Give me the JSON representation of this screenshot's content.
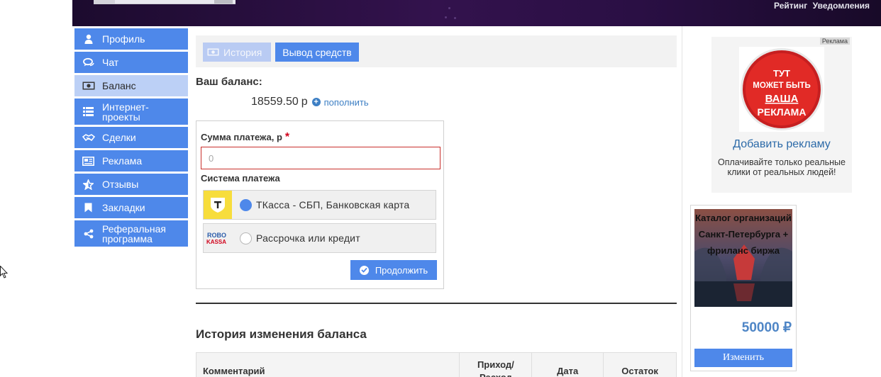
{
  "header": {
    "top_links": [
      "Рейтинг",
      "Уведомления"
    ]
  },
  "sidebar": {
    "items": [
      {
        "label": "Профиль",
        "icon": "user-icon",
        "active": false
      },
      {
        "label": "Чат",
        "icon": "chat-icon",
        "active": false
      },
      {
        "label": "Баланс",
        "icon": "money-icon",
        "active": true
      },
      {
        "label": "Интернет-проекты",
        "icon": "list-icon",
        "active": false
      },
      {
        "label": "Сделки",
        "icon": "handshake-icon",
        "active": false
      },
      {
        "label": "Реклама",
        "icon": "newspaper-icon",
        "active": false
      },
      {
        "label": "Отзывы",
        "icon": "star-icon",
        "active": false
      },
      {
        "label": "Закладки",
        "icon": "bookmark-icon",
        "active": false
      },
      {
        "label": "Реферальная программа",
        "icon": "share-icon",
        "active": false
      }
    ]
  },
  "tabs": {
    "history_label": "История",
    "withdraw_label": "Вывод средств"
  },
  "balance": {
    "label": "Ваш баланс:",
    "value": "18559.50",
    "currency": "р",
    "topup_label": "пополнить"
  },
  "payment_form": {
    "amount_label": "Сумма платежа, р",
    "required_mark": "*",
    "amount_placeholder": "0",
    "system_label": "Система платежа",
    "options": [
      {
        "label": "ТКасса - СБП, Банковская карта",
        "logo": "tkassa-logo",
        "selected": true
      },
      {
        "label": "Рассрочка или кредит",
        "logo": "robokassa-logo",
        "logo_text": [
          "ROBO",
          "KASSA"
        ],
        "selected": false
      }
    ],
    "continue_label": "Продолжить"
  },
  "history": {
    "title": "История изменения баланса",
    "columns": [
      "Комментарий",
      "Приход/ Расход",
      "Дата",
      "Остаток"
    ]
  },
  "ad": {
    "tag": "Реклама",
    "badge_lines": [
      "ТУТ",
      "МОЖЕТ БЫТЬ",
      "ВАША",
      "РЕКЛАМА"
    ],
    "link_label": "Добавить рекламу",
    "description": "Оплачивайте только реальные клики от реальных людей!"
  },
  "catalog": {
    "title": "Каталог организаций Санкт-Петербурга + фриланс биржа",
    "price": "50000 ₽",
    "button_label": "Изменить"
  },
  "colors": {
    "accent": "#4e88ea",
    "active_nav": "#bcd0f6",
    "link": "#2c6aa8",
    "error_border": "#c9302c"
  }
}
